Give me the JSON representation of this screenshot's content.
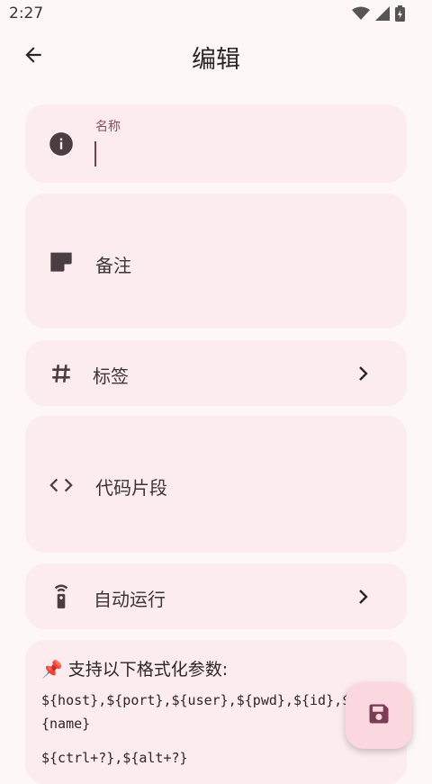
{
  "status_bar": {
    "time": "2:27"
  },
  "app_bar": {
    "title": "编辑"
  },
  "form": {
    "name_label": "名称",
    "name_value": "",
    "note_label": "备注",
    "tags_label": "标签",
    "snippet_label": "代码片段",
    "autorun_label": "自动运行"
  },
  "info": {
    "pin": "📌",
    "title": "支持以下格式化参数:",
    "line1": "${host},${port},${user},${pwd},${id},$",
    "line2": "{name}",
    "line3": "${ctrl+?},${alt+?}"
  },
  "icons": {
    "back": "arrow-back-icon",
    "info": "info-icon",
    "note": "note-icon",
    "tag": "hash-icon",
    "code": "code-icon",
    "autorun": "remote-icon",
    "save": "save-icon"
  },
  "colors": {
    "accent": "#7b3d56",
    "card": "#fdecef",
    "fab": "#fbd8df"
  }
}
